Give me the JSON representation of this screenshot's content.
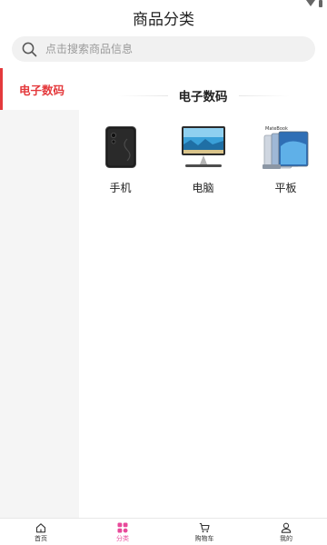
{
  "header": {
    "title": "商品分类"
  },
  "search": {
    "placeholder": "点击搜索商品信息"
  },
  "sidebar": {
    "items": [
      {
        "label": "电子数码",
        "active": true
      }
    ]
  },
  "section": {
    "title": "电子数码",
    "products": [
      {
        "name": "手机",
        "icon": "phone-image"
      },
      {
        "name": "电脑",
        "icon": "computer-image"
      },
      {
        "name": "平板",
        "icon": "tablet-image",
        "image_text": "MateBook"
      }
    ]
  },
  "tabbar": {
    "active_color": "#e8499a",
    "tabs": [
      {
        "label": "首页",
        "icon": "home-icon"
      },
      {
        "label": "分类",
        "icon": "category-icon",
        "active": true
      },
      {
        "label": "购物车",
        "icon": "cart-icon"
      },
      {
        "label": "我的",
        "icon": "user-icon"
      }
    ]
  },
  "colors": {
    "accent": "#e4393c",
    "search_bg": "#f1f1f1",
    "sidebar_bg": "#f5f5f5"
  }
}
